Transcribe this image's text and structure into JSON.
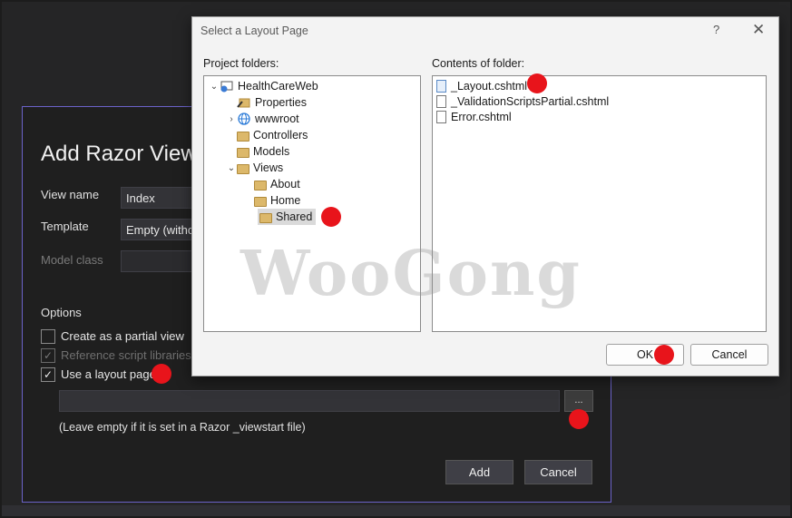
{
  "razor_dialog": {
    "title": "Add Razor View",
    "view_name_label": "View name",
    "view_name_value": "Index",
    "template_label": "Template",
    "template_value": "Empty (withou",
    "model_class_label": "Model class",
    "options_label": "Options",
    "partial_view_label": "Create as a partial view",
    "partial_view_checked": false,
    "reference_scripts_label": "Reference script libraries",
    "reference_scripts_checked": true,
    "use_layout_label": "Use a layout page",
    "use_layout_checked": true,
    "check_glyph": "✓",
    "browse_label": "...",
    "layout_hint": "(Leave empty if it is set in a Razor _viewstart file)",
    "add_label": "Add",
    "cancel_label": "Cancel"
  },
  "layout_dialog": {
    "title": "Select a Layout Page",
    "help_label": "?",
    "close_label": "✕",
    "project_folders_label": "Project folders:",
    "contents_label": "Contents of folder:",
    "tree": [
      {
        "label": "HealthCareWeb",
        "chevron": "⌄",
        "icon": "project-icon"
      },
      {
        "label": "Properties",
        "chevron": "",
        "icon": "properties-icon"
      },
      {
        "label": "wwwroot",
        "chevron": "›",
        "icon": "globe-icon"
      },
      {
        "label": "Controllers",
        "chevron": "",
        "icon": "folder-icon"
      },
      {
        "label": "Models",
        "chevron": "",
        "icon": "folder-icon"
      },
      {
        "label": "Views",
        "chevron": "⌄",
        "icon": "folder-icon"
      },
      {
        "label": "About",
        "chevron": "",
        "icon": "folder-icon"
      },
      {
        "label": "Home",
        "chevron": "",
        "icon": "folder-icon"
      },
      {
        "label": "Shared",
        "chevron": "",
        "icon": "folder-icon",
        "selected": true
      }
    ],
    "files": [
      {
        "label": "_Layout.cshtml",
        "selected": true
      },
      {
        "label": "_ValidationScriptsPartial.cshtml"
      },
      {
        "label": "Error.cshtml"
      }
    ],
    "ok_label": "OK",
    "cancel_label": "Cancel"
  },
  "watermark": "WooGong",
  "colors": {
    "marker": "#e8141b",
    "accent_border": "#6b63c9"
  }
}
